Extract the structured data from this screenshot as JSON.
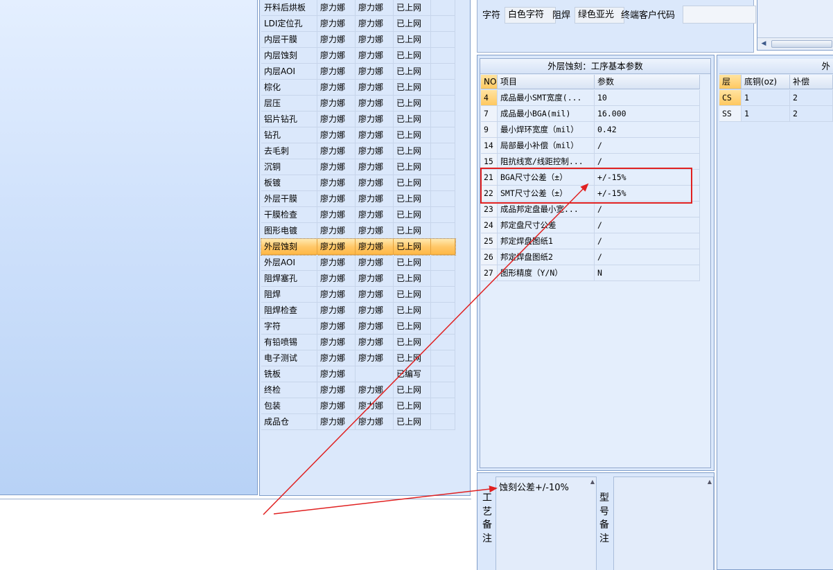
{
  "process_list": [
    {
      "name": "开料后烘板",
      "c2": "廖力娜",
      "c3": "廖力娜",
      "status": "已上网"
    },
    {
      "name": "LDI定位孔",
      "c2": "廖力娜",
      "c3": "廖力娜",
      "status": "已上网"
    },
    {
      "name": "内层干膜",
      "c2": "廖力娜",
      "c3": "廖力娜",
      "status": "已上网"
    },
    {
      "name": "内层蚀刻",
      "c2": "廖力娜",
      "c3": "廖力娜",
      "status": "已上网"
    },
    {
      "name": "内层AOI",
      "c2": "廖力娜",
      "c3": "廖力娜",
      "status": "已上网"
    },
    {
      "name": "棕化",
      "c2": "廖力娜",
      "c3": "廖力娜",
      "status": "已上网"
    },
    {
      "name": "层压",
      "c2": "廖力娜",
      "c3": "廖力娜",
      "status": "已上网"
    },
    {
      "name": "铝片钻孔",
      "c2": "廖力娜",
      "c3": "廖力娜",
      "status": "已上网"
    },
    {
      "name": "钻孔",
      "c2": "廖力娜",
      "c3": "廖力娜",
      "status": "已上网"
    },
    {
      "name": "去毛刺",
      "c2": "廖力娜",
      "c3": "廖力娜",
      "status": "已上网"
    },
    {
      "name": "沉铜",
      "c2": "廖力娜",
      "c3": "廖力娜",
      "status": "已上网"
    },
    {
      "name": "板镀",
      "c2": "廖力娜",
      "c3": "廖力娜",
      "status": "已上网"
    },
    {
      "name": "外层干膜",
      "c2": "廖力娜",
      "c3": "廖力娜",
      "status": "已上网"
    },
    {
      "name": "干膜检查",
      "c2": "廖力娜",
      "c3": "廖力娜",
      "status": "已上网"
    },
    {
      "name": "图形电镀",
      "c2": "廖力娜",
      "c3": "廖力娜",
      "status": "已上网"
    },
    {
      "name": "外层蚀刻",
      "c2": "廖力娜",
      "c3": "廖力娜",
      "status": "已上网",
      "selected": true
    },
    {
      "name": "外层AOI",
      "c2": "廖力娜",
      "c3": "廖力娜",
      "status": "已上网"
    },
    {
      "name": "阻焊塞孔",
      "c2": "廖力娜",
      "c3": "廖力娜",
      "status": "已上网"
    },
    {
      "name": "阻焊",
      "c2": "廖力娜",
      "c3": "廖力娜",
      "status": "已上网"
    },
    {
      "name": "阻焊检查",
      "c2": "廖力娜",
      "c3": "廖力娜",
      "status": "已上网"
    },
    {
      "name": "字符",
      "c2": "廖力娜",
      "c3": "廖力娜",
      "status": "已上网"
    },
    {
      "name": "有铅喷锡",
      "c2": "廖力娜",
      "c3": "廖力娜",
      "status": "已上网"
    },
    {
      "name": "电子测试",
      "c2": "廖力娜",
      "c3": "廖力娜",
      "status": "已上网"
    },
    {
      "name": "铣板",
      "c2": "廖力娜",
      "c3": "",
      "status": "已编写"
    },
    {
      "name": "终检",
      "c2": "廖力娜",
      "c3": "廖力娜",
      "status": "已上网"
    },
    {
      "name": "包装",
      "c2": "廖力娜",
      "c3": "廖力娜",
      "status": "已上网"
    },
    {
      "name": "成品仓",
      "c2": "廖力娜",
      "c3": "廖力娜",
      "status": "已上网"
    }
  ],
  "top_fields": {
    "char_label": "字符",
    "char_value": "白色字符",
    "mask_label": "阻焊",
    "mask_value": "绿色亚光",
    "customer_label": "终端客户代码",
    "customer_value": ""
  },
  "param_panel": {
    "title": "外层蚀刻：工序基本参数",
    "headers": {
      "no": "NO",
      "item": "项目",
      "value": "参数"
    },
    "rows": [
      {
        "no": "4",
        "item": "成品最小SMT宽度(...",
        "value": "10"
      },
      {
        "no": "7",
        "item": "成品最小BGA(mil)",
        "value": "16.000"
      },
      {
        "no": "9",
        "item": "最小焊环宽度（mil）",
        "value": "0.42"
      },
      {
        "no": "14",
        "item": "局部最小补偿（mil）",
        "value": "/"
      },
      {
        "no": "15",
        "item": "阻抗线宽/线距控制...",
        "value": "/"
      },
      {
        "no": "21",
        "item": "BGA尺寸公差（±）",
        "value": "+/-15%"
      },
      {
        "no": "22",
        "item": "SMT尺寸公差（±）",
        "value": "+/-15%"
      },
      {
        "no": "23",
        "item": "成品邦定盘最小宽...",
        "value": "/"
      },
      {
        "no": "24",
        "item": "邦定盘尺寸公差",
        "value": "/"
      },
      {
        "no": "25",
        "item": "邦定焊盘图纸1",
        "value": "/"
      },
      {
        "no": "26",
        "item": "邦定焊盘图纸2",
        "value": "/"
      },
      {
        "no": "27",
        "item": "图形精度（Y/N）",
        "value": "N"
      }
    ]
  },
  "right_panel": {
    "title": "外",
    "headers": {
      "layer": "层",
      "copper": "底铜(oz)",
      "comp": "补偿"
    },
    "rows": [
      {
        "layer": "CS",
        "copper": "1",
        "comp": "2"
      },
      {
        "layer": "SS",
        "copper": "1",
        "comp": "2"
      }
    ]
  },
  "notes": {
    "process_label": [
      "工",
      "艺",
      "备",
      "注"
    ],
    "process_text": "蚀刻公差+/-10%",
    "model_label": [
      "型",
      "号",
      "备",
      "注"
    ],
    "model_text": ""
  },
  "colors": {
    "annotation": "#e02020",
    "selected_row": "#ffc86a",
    "panel": "#dbe8fb"
  }
}
